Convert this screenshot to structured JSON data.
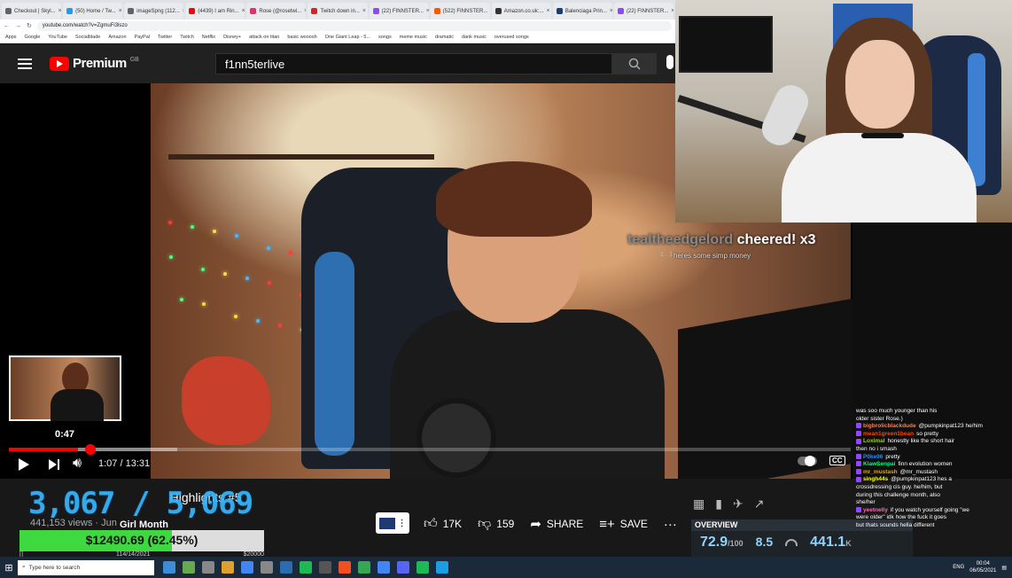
{
  "browser": {
    "tabs": [
      {
        "title": "Checkout | Skyl...",
        "color": "#5f6368"
      },
      {
        "title": "(50) Home / Tw...",
        "color": "#1d9bf0"
      },
      {
        "title": "imageSpng (112...",
        "color": "#5f6368"
      },
      {
        "title": "(4439) I am Rin...",
        "color": "#ff0000"
      },
      {
        "title": "Rose (@rosetwi...",
        "color": "#e1306c"
      },
      {
        "title": "Twitch down in...",
        "color": "#e02020"
      },
      {
        "title": "(22) FINNSTER...",
        "color": "#9146ff"
      },
      {
        "title": "(522) FINNSTER...",
        "color": "#ff5700"
      },
      {
        "title": "Amazon.co.uk:...",
        "color": "#333333"
      },
      {
        "title": "Balenciaga Prin...",
        "color": "#1a3c6e"
      },
      {
        "title": "(22) FINNSTER...",
        "color": "#9146ff"
      }
    ],
    "url": "youtube.com/watch?v=ZgmuFi3lszo",
    "bookmarks": [
      "Apps",
      "Google",
      "YouTube",
      "Socialblade",
      "Amazon",
      "PayPal",
      "Twitter",
      "Twitch",
      "Netflix",
      "Disney+",
      "attack on titan",
      "basic wooosh",
      "One Giant Leap - 5...",
      "songs",
      "meme music",
      "dramatic",
      "dank music",
      "overused songs"
    ]
  },
  "youtube": {
    "brand": "Premium",
    "region": "GB",
    "search_value": "f1nn5terlive"
  },
  "stream_overlay": {
    "cheer_user": "tealtheedgelord",
    "cheer_text": "cheered!",
    "cheer_count": "x3",
    "cheer_dots": "1 · 1",
    "cheer_message": "heres some simp money",
    "sub_counter": "3,067 / 5,069",
    "goal_label": "Girl Month",
    "goal_text": "$12490.69 (62.45%)",
    "goal_fraction": 0.6245,
    "goal_left": "[]",
    "goal_right": "$20000",
    "goal_mid": "114/14/2021"
  },
  "player": {
    "preview_time": "0:47",
    "time_current": "1:07",
    "time_total": "13:31",
    "played_fraction": 0.082,
    "buffered_fraction": 0.2
  },
  "video": {
    "title": "1:07 / 13:31 | F1NN5TER Highlights #5",
    "title_visible": "Highlights #5",
    "views": "441,153 views · Jun",
    "likes": "17K",
    "dislikes": "159",
    "share_label": "SHARE",
    "save_label": "SAVE"
  },
  "overview": {
    "header": "OVERVIEW",
    "score": "72.9",
    "score_max": "/100",
    "ratio": "8.5",
    "count": "441.1",
    "count_unit": "K"
  },
  "chat": [
    {
      "user": "",
      "text": "was soo much younger than his",
      "color": "#fff"
    },
    {
      "user": "",
      "text": "older sister Rose.)",
      "color": "#fff"
    },
    {
      "user": "bigbrolicblackdude",
      "text": "@pumpkinpat123 he/him",
      "color": "#ff7f50"
    },
    {
      "user": "mean1green1bean",
      "text": "so pretty",
      "color": "#ff4500"
    },
    {
      "user": "Loximal",
      "text": "honestly like the short hair",
      "color": "#9acd32"
    },
    {
      "user": "",
      "text": "then no i smash",
      "color": "#fff"
    },
    {
      "user": "P0ke96",
      "text": "pretty",
      "color": "#1e90ff"
    },
    {
      "user": "KlawSenpai",
      "text": "finn evolution women",
      "color": "#00ff7f"
    },
    {
      "user": "mr_mustash",
      "text": "@mr_mustash",
      "color": "#daa520"
    },
    {
      "user": "singh44s",
      "text": "@pumpkinpat123 hes a",
      "color": "#ffff00"
    },
    {
      "user": "",
      "text": "crossdressing cis guy. he/him, but",
      "color": "#fff"
    },
    {
      "user": "",
      "text": "during this challenge month, also",
      "color": "#fff"
    },
    {
      "user": "",
      "text": "she/her",
      "color": "#fff"
    },
    {
      "user": "yeetnelly",
      "text": "if you watch yourself going \"we",
      "color": "#ff69b4"
    },
    {
      "user": "",
      "text": "were older\" idk how the fuck it goes",
      "color": "#fff"
    },
    {
      "user": "",
      "text": "but thats sounds hella different",
      "color": "#fff"
    }
  ],
  "taskbar": {
    "search_placeholder": "Type here to search",
    "lang": "ENG",
    "time": "00:04",
    "date": "06/05/2021"
  }
}
